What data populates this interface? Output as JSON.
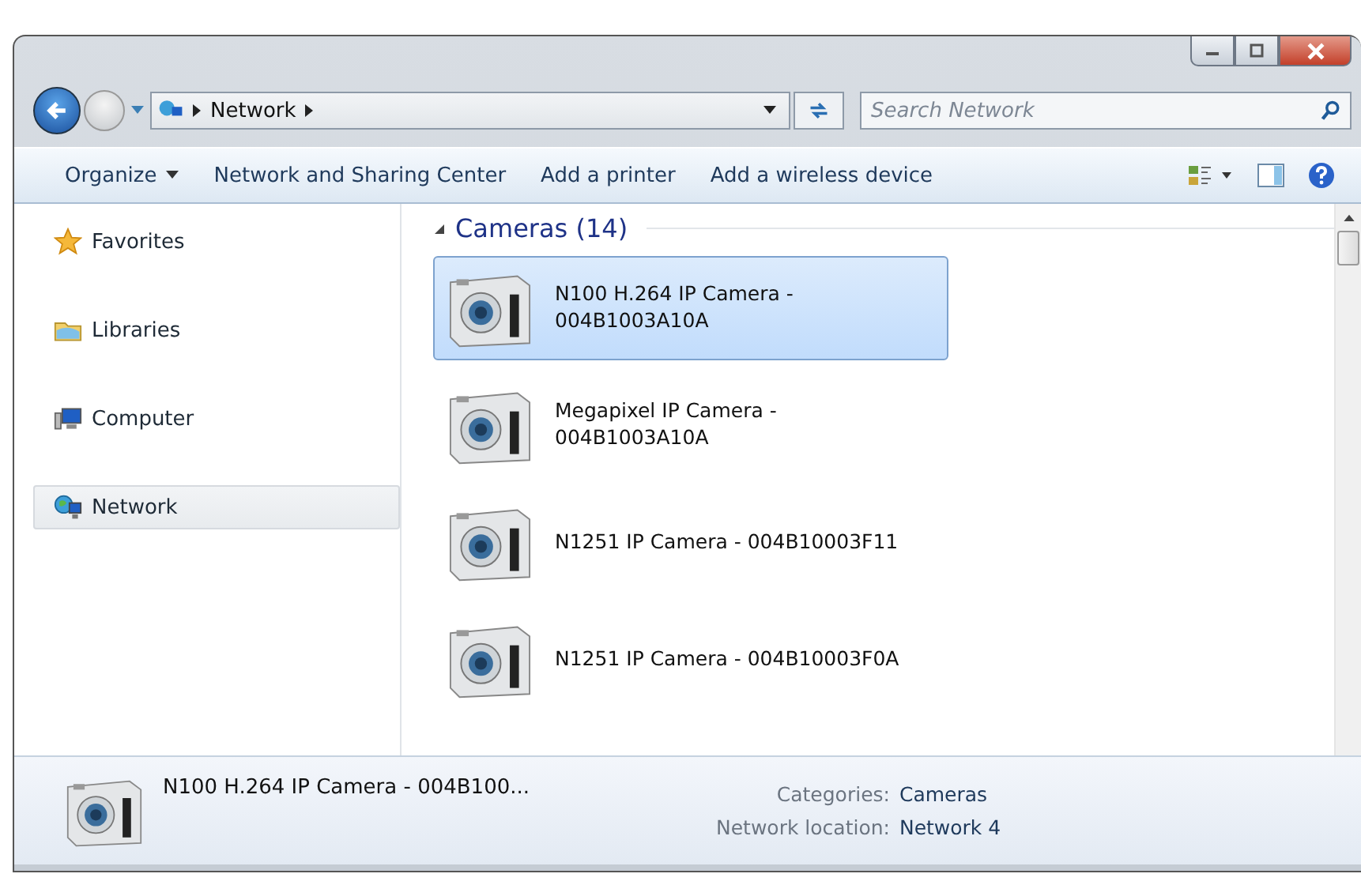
{
  "address": {
    "crumbs": [
      "Network"
    ]
  },
  "search": {
    "placeholder": "Search Network"
  },
  "toolbar": {
    "items": [
      "Organize",
      "Network and Sharing Center",
      "Add a printer",
      "Add a wireless device"
    ]
  },
  "sidebar": {
    "items": [
      {
        "label": "Favorites",
        "kind": "star",
        "selected": false
      },
      {
        "label": "Libraries",
        "kind": "folder",
        "selected": false
      },
      {
        "label": "Computer",
        "kind": "computer",
        "selected": false
      },
      {
        "label": "Network",
        "kind": "network",
        "selected": true
      }
    ]
  },
  "group": {
    "title": "Cameras (14)",
    "expanded": true
  },
  "items": [
    {
      "name": "N100 H.264 IP Camera -\n004B1003A10A",
      "selected": true
    },
    {
      "name": "Megapixel IP Camera -\n004B1003A10A",
      "selected": false
    },
    {
      "name": "N1251 IP Camera - 004B10003F11",
      "selected": false
    },
    {
      "name": "N1251 IP Camera - 004B10003F0A",
      "selected": false
    }
  ],
  "details": {
    "name": "N100 H.264 IP Camera - 004B100...",
    "fields": [
      {
        "label": "Categories:",
        "value": "Cameras"
      },
      {
        "label": "Network location:",
        "value": "Network 4"
      }
    ]
  }
}
